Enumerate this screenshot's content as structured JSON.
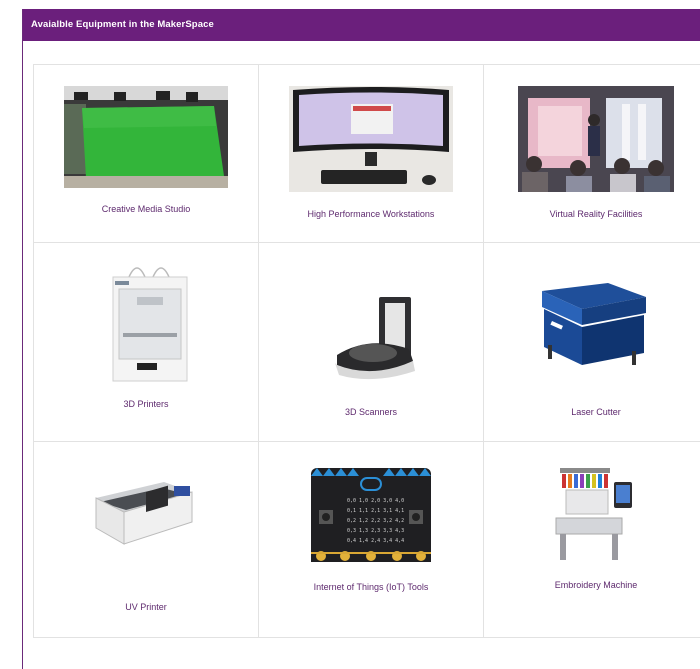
{
  "header": {
    "title": "Avaialble Equipment in the MakerSpace"
  },
  "equipment": [
    {
      "label": "Creative Media Studio",
      "icon": "green-screen-studio-photo"
    },
    {
      "label": "High Performance Workstations",
      "icon": "curved-monitor-workstation-photo"
    },
    {
      "label": "Virtual Reality Facilities",
      "icon": "vr-room-photo"
    },
    {
      "label": "3D Printers",
      "icon": "3d-printer-photo"
    },
    {
      "label": "3D Scanners",
      "icon": "3d-scanner-photo"
    },
    {
      "label": "Laser Cutter",
      "icon": "laser-cutter-photo"
    },
    {
      "label": "UV Printer",
      "icon": "uv-printer-photo"
    },
    {
      "label": "Internet of Things (IoT) Tools",
      "icon": "microbit-board-photo"
    },
    {
      "label": "Embroidery Machine",
      "icon": "embroidery-machine-photo"
    }
  ],
  "colors": {
    "header_bg": "#6b1f7c",
    "caption": "#5e2a6e",
    "grid_border": "#e2e2e2"
  }
}
